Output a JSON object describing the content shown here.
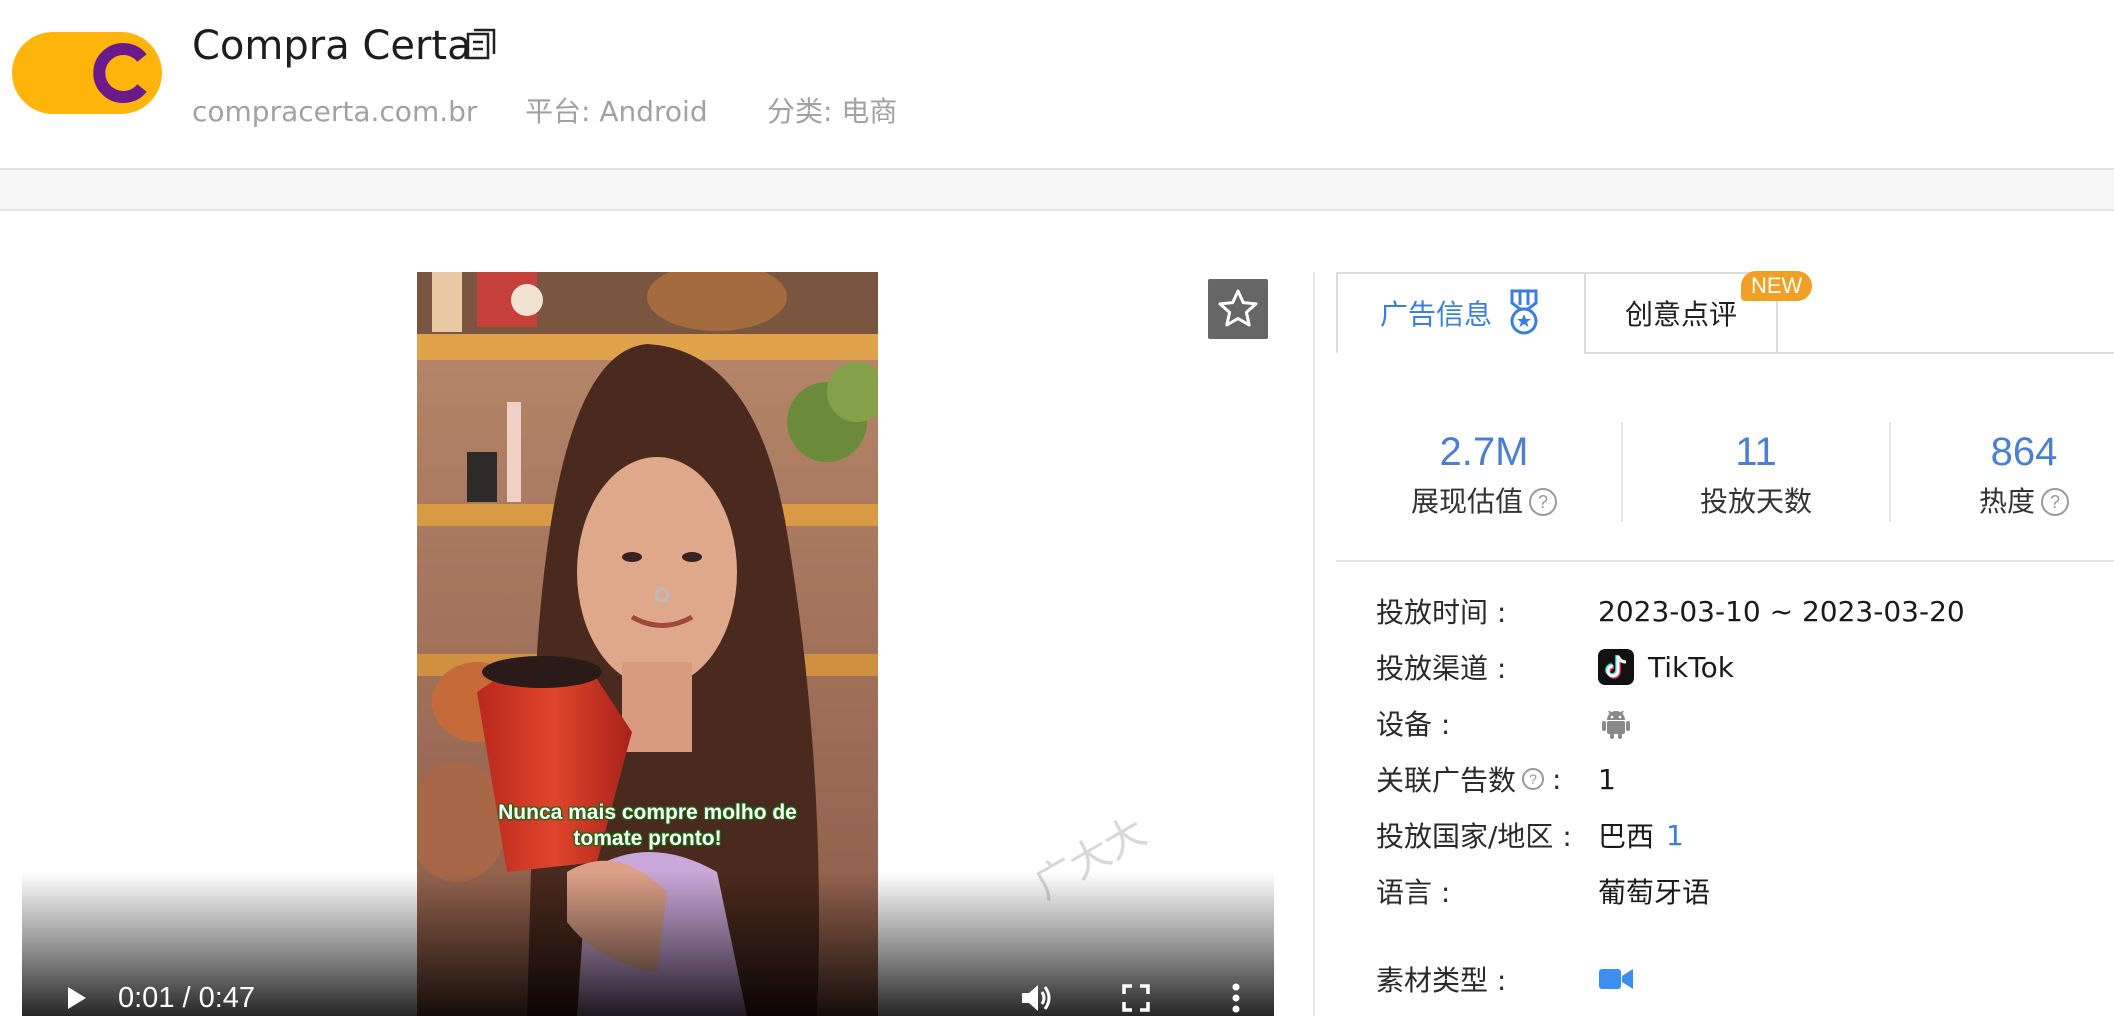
{
  "header": {
    "app_name": "Compra Certa",
    "domain": "compracerta.com.br",
    "platform": "平台: Android",
    "category": "分类: 电商"
  },
  "video": {
    "caption_line1": "Nunca mais compre molho de",
    "caption_line2": "tomate pronto!",
    "watermark": "广大大",
    "time": "0:01 / 0:47"
  },
  "tabs": [
    {
      "label": "广告信息",
      "active": true
    },
    {
      "label": "创意点评",
      "active": false
    }
  ],
  "new_badge": "NEW",
  "stats": [
    {
      "value": "2.7M",
      "label": "展现估值",
      "help": "?"
    },
    {
      "value": "11",
      "label": "投放天数"
    },
    {
      "value": "864",
      "label": "热度",
      "help": "?"
    }
  ],
  "info": {
    "period_label": "投放时间 :",
    "period_value": "2023-03-10 ~ 2023-03-20",
    "channel_label": "投放渠道 :",
    "channel_value": "TikTok",
    "device_label": "设备 :",
    "device_icon": "android-icon",
    "related_label": "关联广告数",
    "related_colon": ":",
    "related_value": "1",
    "country_label": "投放国家/地区 :",
    "country_value": "巴西",
    "country_count": "1",
    "language_label": "语言 :",
    "language_value": "葡萄牙语",
    "material_label": "素材类型 :",
    "material_icon": "video-camera-icon"
  },
  "colors": {
    "accent": "#3a7fe0",
    "stat_value": "#4a7fd4",
    "brand_yellow": "#ffb40a",
    "brand_purple": "#6a1a8a",
    "badge": "#f0a024"
  }
}
